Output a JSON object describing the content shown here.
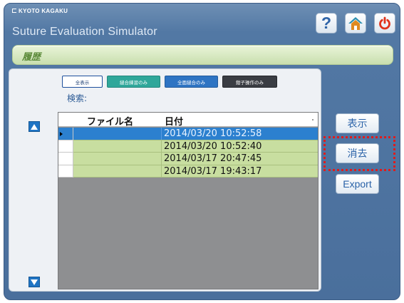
{
  "header": {
    "brand": "KYOTO KAGAKU",
    "app_title": "Suture Evaluation Simulator",
    "help_label": "?"
  },
  "breadcrumb": {
    "label": "履歴"
  },
  "filters": {
    "all": "全表示",
    "green": "縫合練習のみ",
    "blue": "全面縫合のみ",
    "dark": "鉗子操作のみ"
  },
  "search": {
    "label": "検索:"
  },
  "table": {
    "columns": [
      "ファイル名",
      "日付"
    ],
    "rows": [
      {
        "file": "",
        "date": "2014/03/20 10:52:58",
        "selected": true
      },
      {
        "file": "",
        "date": "2014/03/20 10:52:40",
        "selected": false
      },
      {
        "file": "",
        "date": "2014/03/17 20:47:45",
        "selected": false
      },
      {
        "file": "",
        "date": "2014/03/17 19:43:17",
        "selected": false
      }
    ]
  },
  "actions": {
    "show": "表示",
    "delete": "消去",
    "export": "Export"
  },
  "colors": {
    "app_bg": "#5278a4",
    "row_green": "#c8dea0",
    "row_selected": "#2c80cf",
    "highlight": "#e01b1b"
  },
  "icons": {
    "help": "help-icon",
    "home": "home-icon",
    "power": "power-icon",
    "scroll_up": "triangle-up-icon",
    "scroll_down": "triangle-down-icon"
  }
}
